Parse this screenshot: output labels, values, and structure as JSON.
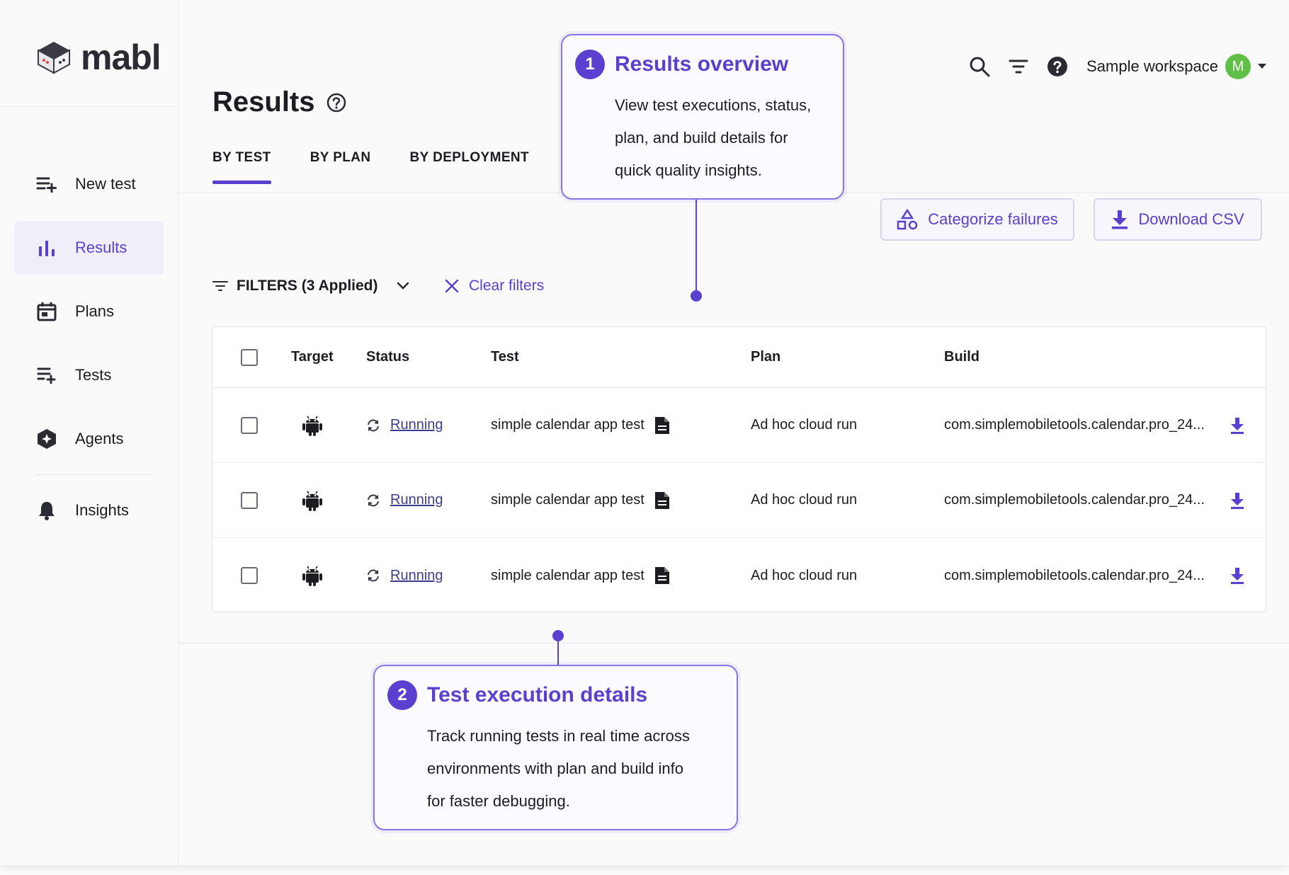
{
  "app": {
    "name": "mabl"
  },
  "sidebar": {
    "items": [
      {
        "label": "New test",
        "icon": "playlist-add-icon"
      },
      {
        "label": "Results",
        "icon": "bar-chart-icon",
        "active": true
      },
      {
        "label": "Plans",
        "icon": "calendar-icon"
      },
      {
        "label": "Tests",
        "icon": "list-add-icon"
      },
      {
        "label": "Agents",
        "icon": "agent-hex-icon"
      },
      {
        "label": "Insights",
        "icon": "bell-icon"
      }
    ]
  },
  "header": {
    "title": "Results",
    "workspace": "Sample workspace",
    "avatar_initial": "M"
  },
  "tabs": [
    {
      "label": "BY TEST",
      "active": true
    },
    {
      "label": "BY PLAN"
    },
    {
      "label": "BY DEPLOYMENT"
    }
  ],
  "actions": {
    "categorize": "Categorize failures",
    "download": "Download CSV"
  },
  "filters": {
    "label": "FILTERS (3 Applied)",
    "clear": "Clear filters"
  },
  "table": {
    "columns": [
      "Target",
      "Status",
      "Test",
      "Plan",
      "Build"
    ],
    "rows": [
      {
        "status": "Running",
        "test": "simple calendar app test",
        "plan": "Ad hoc cloud run",
        "build": "com.simplemobiletools.calendar.pro_24..."
      },
      {
        "status": "Running",
        "test": "simple calendar app test",
        "plan": "Ad hoc cloud run",
        "build": "com.simplemobiletools.calendar.pro_24..."
      },
      {
        "status": "Running",
        "test": "simple calendar app test",
        "plan": "Ad hoc cloud run",
        "build": "com.simplemobiletools.calendar.pro_24..."
      }
    ]
  },
  "callouts": [
    {
      "number": "1",
      "title": "Results overview",
      "lines": [
        "View test executions, status,",
        "plan, and build details for",
        "quick quality insights."
      ]
    },
    {
      "number": "2",
      "title": "Test execution details",
      "lines": [
        "Track running tests in real time across",
        "environments with plan and build info",
        "for faster debugging."
      ]
    }
  ],
  "colors": {
    "accent": "#5a3fd1",
    "avatar": "#5fbf47"
  }
}
